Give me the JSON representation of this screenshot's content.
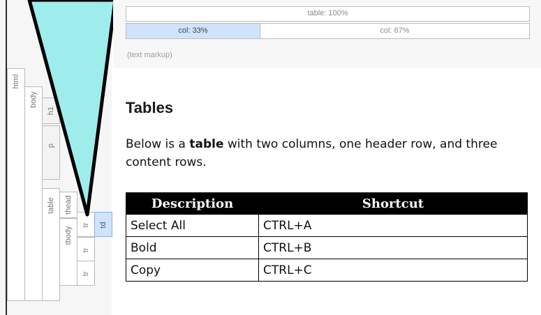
{
  "structure_tags": {
    "html": "html",
    "body": "body",
    "h1": "h1",
    "p": "p",
    "table": "table",
    "thead": "thead",
    "tbody": "tbody",
    "tr_head": "tr",
    "td": "td",
    "tr_1": "tr",
    "tr_2": "tr"
  },
  "header": {
    "table_width": "table: 100%",
    "col_1": "col: 33%",
    "col_2": "col: 67%",
    "markup_note": "(text markup)"
  },
  "document": {
    "title": "Tables",
    "paragraph_before": "Below is a ",
    "paragraph_bold": "table",
    "paragraph_after": " with two columns, one header row, and three content rows."
  },
  "table": {
    "headers": [
      "Description",
      "Shortcut"
    ],
    "rows": [
      [
        "Select All",
        "CTRL+A"
      ],
      [
        "Bold",
        "CTRL+B"
      ],
      [
        "Copy",
        "CTRL+C"
      ]
    ]
  },
  "colors": {
    "pointer_fill": "#9eeceb",
    "selected_tag": "#cfe3fb",
    "header_bg": "#000000"
  }
}
